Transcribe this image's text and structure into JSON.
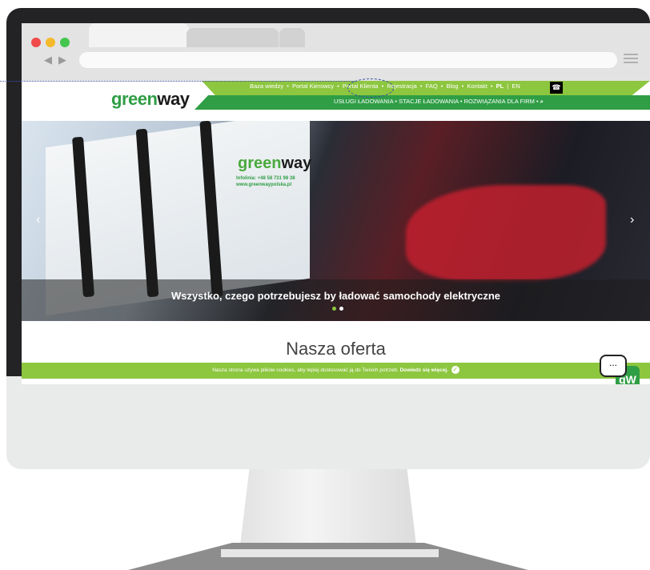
{
  "browser": {
    "back_label": "◀",
    "forward_label": "▶"
  },
  "site": {
    "logo_prefix": "green",
    "logo_suffix": "way",
    "top_nav": [
      "Baza wiedzy",
      "Portal Kierowcy",
      "Portal Klienta",
      "Rejestracja",
      "FAQ",
      "Blog",
      "Kontakt",
      "PL",
      "EN"
    ],
    "secondary_nav": [
      "USŁUGI ŁADOWANIA",
      "STACJE ŁADOWANIA",
      "ROZWIĄZANIA DLA FIRM"
    ],
    "separator": "•",
    "lang_divider": "|",
    "phone_icon": "☎",
    "search_icon": "⌕"
  },
  "hero": {
    "caption": "Wszystko, czego potrzebujesz by ładować samochody elektryczne",
    "station_logo_prefix": "green",
    "station_logo_suffix": "way",
    "station_info_line1": "Infolinia: +48 58 731 98 38",
    "station_info_line2": "www.greenwaypolska.pl",
    "prev_arrow": "‹",
    "next_arrow": "›",
    "active_dot_color": "#8dc63f",
    "inactive_dot_color": "#ffffff"
  },
  "content": {
    "section_title": "Nasza oferta"
  },
  "cookie": {
    "text": "Nasza strona używa plików cookies, aby lepiej dostosować ją do Twoich potrzeb.",
    "link": "Dowiedz się więcej.",
    "check_icon": "✓"
  },
  "chat": {
    "bubble_text": "...",
    "badge_text": "gW"
  },
  "colors": {
    "brand_green": "#2f9e45",
    "light_green": "#8dc63f"
  }
}
